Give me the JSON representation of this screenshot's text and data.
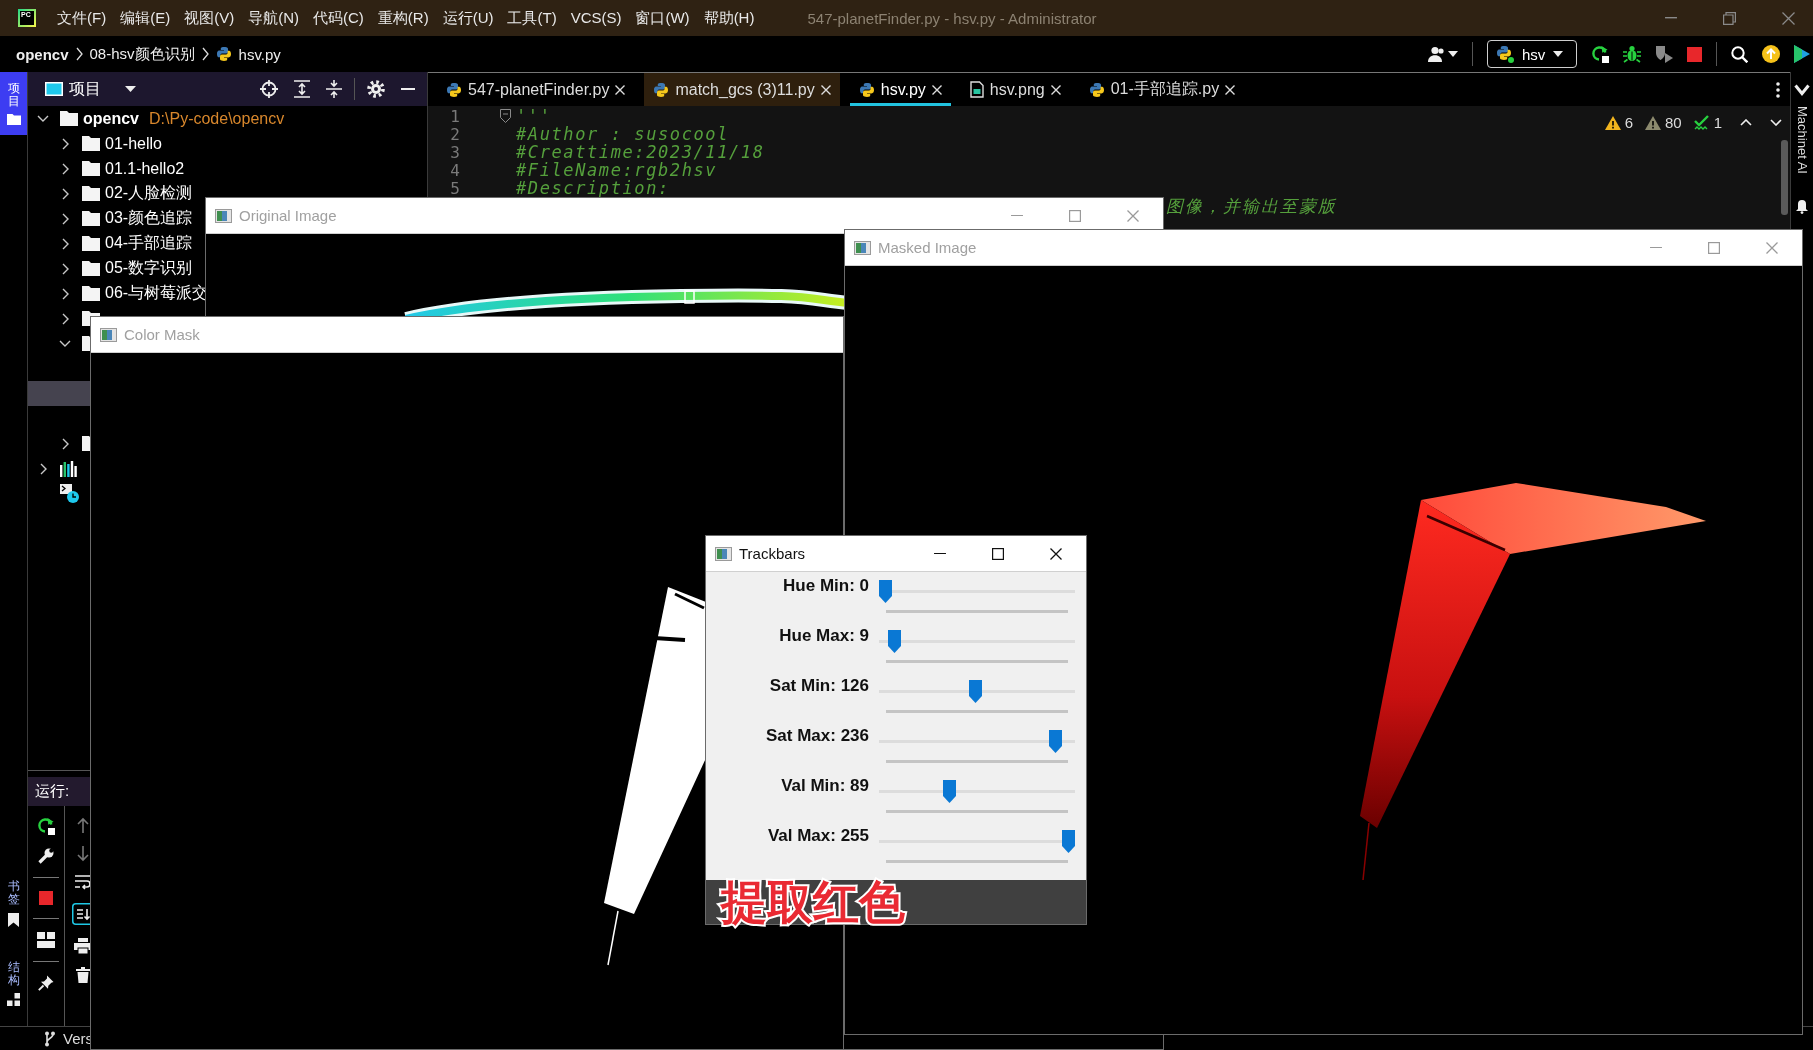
{
  "title_bar": {
    "logo_text": "PC",
    "menus": [
      "文件(F)",
      "编辑(E)",
      "视图(V)",
      "导航(N)",
      "代码(C)",
      "重构(R)",
      "运行(U)",
      "工具(T)",
      "VCS(S)",
      "窗口(W)",
      "帮助(H)"
    ],
    "title": "547-planetFinder.py - hsv.py - Administrator"
  },
  "nav_bar": {
    "breadcrumbs": [
      "opencv",
      "08-hsv颜色识别",
      "hsv.py"
    ],
    "run_config": "hsv"
  },
  "tool_strip": {
    "top": [
      {
        "kind": "project",
        "label": "项目",
        "selected": true
      }
    ],
    "bottom": [
      {
        "kind": "bookmarks",
        "label": "书签",
        "selected": false
      },
      {
        "kind": "structure",
        "label": "结构",
        "selected": false
      }
    ]
  },
  "project_panel": {
    "title": "项目",
    "tree": [
      {
        "kind": "folder",
        "label": "opencv",
        "path": "D:\\Py-code\\opencv",
        "expanded": true,
        "selected": false,
        "children": [
          {
            "kind": "folder",
            "label": "01-hello",
            "expanded": false,
            "selected": false
          },
          {
            "kind": "folder",
            "label": "01.1-hello2",
            "expanded": false,
            "selected": false
          },
          {
            "kind": "folder",
            "label": "02-人脸检测",
            "expanded": false,
            "selected": false
          },
          {
            "kind": "folder",
            "label": "03-颜色追踪",
            "expanded": false,
            "selected": false
          },
          {
            "kind": "folder",
            "label": "04-手部追踪",
            "expanded": false,
            "selected": false
          },
          {
            "kind": "folder",
            "label": "05-数字识别",
            "expanded": false,
            "selected": false
          },
          {
            "kind": "folder",
            "label": "06-与树莓派交",
            "expanded": false,
            "selected": false
          },
          {
            "kind": "folder",
            "expanded": false,
            "selected": false
          },
          {
            "kind": "folder",
            "expanded": true,
            "selected": false,
            "children": [
              {
                "selected": false
              },
              {
                "selected": true
              },
              {
                "selected": false
              }
            ]
          },
          {
            "kind": "folder",
            "expanded": false,
            "selected": false
          }
        ]
      },
      {
        "kind": "libraries",
        "expanded": false,
        "selected": false
      },
      {
        "kind": "scratches",
        "selected": false
      }
    ]
  },
  "run_panel": {
    "title": "运行:"
  },
  "status_bar": {
    "vcs": "Vers"
  },
  "editor": {
    "tabs": [
      {
        "kind": "python",
        "label": "547-planetFinder.py",
        "selected": false,
        "color": "#000000"
      },
      {
        "kind": "python",
        "label": "match_gcs (3)11.py",
        "selected": false,
        "color": "#2e1f0d"
      },
      {
        "kind": "python",
        "label": "hsv.py",
        "selected": true,
        "color": "#000000"
      },
      {
        "kind": "image",
        "label": "hsv.png",
        "selected": false,
        "color": "#000000"
      },
      {
        "kind": "python",
        "label": "01-手部追踪.py",
        "selected": false,
        "color": "#000000"
      }
    ],
    "inspections": [
      {
        "kind": "warning",
        "count": "6"
      },
      {
        "kind": "weak_warning",
        "count": "80"
      },
      {
        "kind": "typo",
        "count": "1"
      }
    ],
    "lines": [
      {
        "kind": "code",
        "number": "1",
        "text": "'''"
      },
      {
        "kind": "code",
        "number": "2",
        "text": "#Author : susocool"
      },
      {
        "kind": "code",
        "number": "3",
        "text": "#Creattime:2023/11/18"
      },
      {
        "kind": "code",
        "number": "4",
        "text": "#FileName:rgb2hsv"
      },
      {
        "kind": "code",
        "number": "5",
        "text": "#Description:"
      },
      {
        "kind": "fragment",
        "text": "图像，并输出至蒙版"
      }
    ]
  },
  "right_strip": {
    "label": "Machinet AI"
  },
  "windows": [
    {
      "kind": "image",
      "title": "Original Image",
      "active": false
    },
    {
      "kind": "image",
      "title": "Color Mask",
      "active": false
    },
    {
      "kind": "image",
      "title": "Masked Image",
      "active": false
    },
    {
      "kind": "trackbars",
      "title": "Trackbars",
      "active": true,
      "trackbars": [
        {
          "label": "Hue Min: 0",
          "level": 0
        },
        {
          "label": "Hue Max: 9",
          "level": 0.05
        },
        {
          "label": "Sat Min: 126",
          "level": 0.49
        },
        {
          "label": "Sat Max: 236",
          "level": 0.93
        },
        {
          "label": "Val Min: 89",
          "level": 0.35
        },
        {
          "label": "Val Max: 255",
          "level": 1
        }
      ],
      "caption": "提取红色"
    }
  ]
}
